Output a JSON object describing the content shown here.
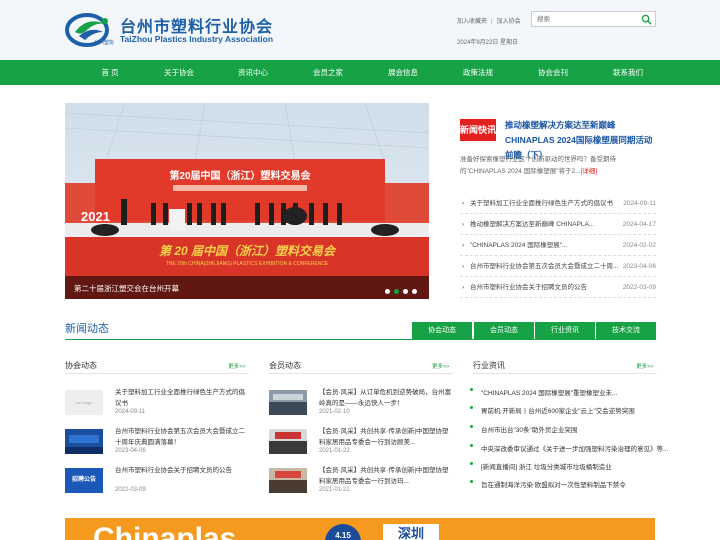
{
  "site": {
    "name_cn": "台州市塑料行业协会",
    "name_en": "TaiZhou Plastics Industry Association",
    "logo_text": "台州塑协"
  },
  "top": {
    "links": [
      "加入收藏夹",
      "加入协会"
    ],
    "search_placeholder": "搜索",
    "date_text": "2024年9月22日  星期日"
  },
  "nav": {
    "items": [
      "首 页",
      "关于协会",
      "资讯中心",
      "会员之家",
      "展会信息",
      "政策法规",
      "协会会刊",
      "联系我们"
    ]
  },
  "banner": {
    "caption": "第二十届浙江塑交会在台州开幕",
    "stage_title": "第20届中国（浙江）塑料交易会",
    "floor_title": "第 20 届中国（浙江）塑料交易会",
    "floor_subtitle": "THE 20th CHINA(ZHEJIANG) PLASTICS EXHIBITION & CONFERENCE",
    "year": "2021",
    "slide_count": 4,
    "active_slide": 2
  },
  "headline": {
    "badge": "新闻快讯",
    "title": "推动橡塑解决方案达至新巅峰 CHINAPLAS 2024国际橡塑展同期活动前瞻（下）",
    "desc": "准备好探索橡塑行业这个创新驱动的世界吗？备受期待的\"CHINAPLAS 2024 国际橡塑展\"将于2...",
    "more": "[详细]"
  },
  "news_list": [
    {
      "title": "关于塑料加工行业全面推行绿色生产方式的倡议书",
      "date": "2024-09-11"
    },
    {
      "title": "推动橡塑解决方案达至新巅峰 CHINAPLA...",
      "date": "2024-04-17"
    },
    {
      "title": "\"CHINAPLAS 2024 国际橡塑展\"...",
      "date": "2024-02-02"
    },
    {
      "title": "台州市塑料行业协会第五次会员大会暨成立二十周...",
      "date": "2023-04-06"
    },
    {
      "title": "台州市塑料行业协会关于招聘文员的公告",
      "date": "2022-03-09"
    }
  ],
  "section": {
    "title": "新闻动态",
    "tabs": [
      "协会动态",
      "会员动态",
      "行业资讯",
      "技术交流"
    ]
  },
  "assoc": {
    "heading": "协会动态",
    "more": "更多>>",
    "items": [
      {
        "title": "关于塑料加工行业全面推行绿色生产方式的倡议书",
        "date": "2024-09-11",
        "thumb": "no image"
      },
      {
        "title": "台州市塑料行业协会第五次会员大会暨成立二十周年庆典圆满落幕！",
        "date": "2023-04-06",
        "thumb": ""
      },
      {
        "title": "台州市塑料行业协会关于招聘文员的公告",
        "date": "2022-03-09",
        "thumb": "招聘公告"
      }
    ]
  },
  "member": {
    "heading": "会员动态",
    "more": "更多>>",
    "items": [
      {
        "title": "【会员·风采】从订单危机到逆势破局，台州富岭真的是——永远快人一步！",
        "date": "2021-02-10"
      },
      {
        "title": "【会员·风采】共创共享·传承创新|中国塑协塑料家居用品专委会一行到访顾美...",
        "date": "2021-01-22"
      },
      {
        "title": "【会员·风采】共创共享·传承创新|中国塑协塑料家居用品专委会一行到访玛...",
        "date": "2021-01-22"
      }
    ]
  },
  "industry": {
    "heading": "行业资讯",
    "more": "更多>>",
    "items": [
      "\"CHINAPLAS 2024 国际橡塑展\"重塑橡塑业未...",
      "胃前机 开新局丨台州近600家企业\"云上\"交会逆势突围",
      "台州市出台\"30条\"助外贸企业突围",
      "中央深改委审议通过《关于进一步加强塑料污染治理的意见》等...",
      "[新闻直播间] 浙江 垃圾分类城市垃圾桶制造业",
      "旨在通制海洋污染 欧盟拟对一次性塑料制品下禁令"
    ]
  },
  "ad": {
    "text": "Chinaplas",
    "date": "4.15",
    "city": "深圳"
  },
  "colors": {
    "brand_green": "#17a345",
    "brand_blue": "#1d5fa8",
    "accent_red": "#e4211f",
    "ad_orange": "#f59a1f"
  }
}
